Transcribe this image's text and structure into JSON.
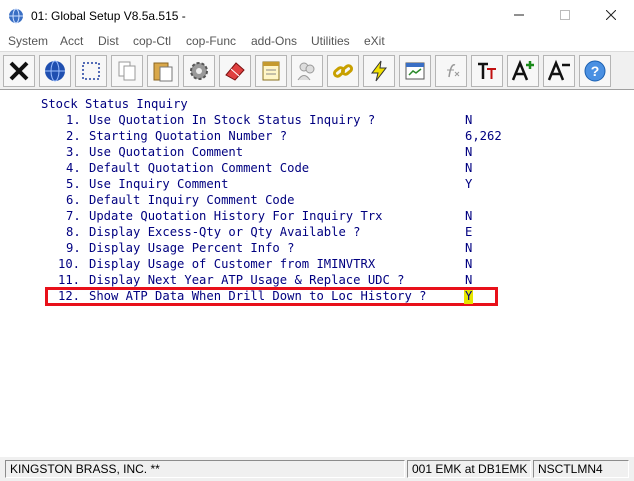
{
  "window": {
    "title": "01: Global Setup V8.5a.515 -",
    "minimize_icon": "minimize-icon",
    "maximize_icon": "maximize-icon",
    "close_icon": "close-icon"
  },
  "menu": {
    "items": [
      {
        "label": "System"
      },
      {
        "label": "Acct"
      },
      {
        "label": "Dist"
      },
      {
        "label": "cop-Ctl"
      },
      {
        "label": "cop-Func"
      },
      {
        "label": "add-Ons"
      },
      {
        "label": "Utilities"
      },
      {
        "label": "eXit"
      }
    ]
  },
  "toolbar": {
    "buttons": [
      {
        "icon": "close-x-icon"
      },
      {
        "icon": "globe-icon"
      },
      {
        "icon": "select-rectangle-icon"
      },
      {
        "icon": "copy-icon"
      },
      {
        "icon": "paste-icon"
      },
      {
        "icon": "settings-gear-icon"
      },
      {
        "icon": "eraser-icon"
      },
      {
        "icon": "notepad-icon"
      },
      {
        "icon": "users-icon"
      },
      {
        "icon": "link-chain-icon"
      },
      {
        "icon": "lightning-icon"
      },
      {
        "icon": "report-icon"
      },
      {
        "icon": "function-icon"
      },
      {
        "icon": "text-format-icon"
      },
      {
        "icon": "font-increase-icon"
      },
      {
        "icon": "font-decrease-icon"
      },
      {
        "icon": "help-icon"
      }
    ]
  },
  "screen": {
    "heading": "Stock Status Inquiry",
    "options": [
      {
        "num": "1.",
        "label": "Use Quotation In Stock Status Inquiry ?",
        "value": "N"
      },
      {
        "num": "2.",
        "label": "Starting Quotation Number ?",
        "value": "6,262"
      },
      {
        "num": "3.",
        "label": "Use Quotation Comment",
        "value": "N"
      },
      {
        "num": "4.",
        "label": "Default Quotation Comment Code",
        "value": "N"
      },
      {
        "num": "5.",
        "label": "Use Inquiry Comment",
        "value": "Y"
      },
      {
        "num": "6.",
        "label": "Default Inquiry Comment Code",
        "value": ""
      },
      {
        "num": "7.",
        "label": "Update Quotation History For Inquiry Trx",
        "value": "N"
      },
      {
        "num": "8.",
        "label": "Display Excess-Qty or Qty Available ?",
        "value": "E"
      },
      {
        "num": "9.",
        "label": "Display Usage Percent Info ?",
        "value": "N"
      },
      {
        "num": "10.",
        "label": "Display Usage of Customer from IMINVTRX",
        "value": "N"
      },
      {
        "num": "11.",
        "label": "Display Next Year ATP Usage & Replace UDC ?",
        "value": "N"
      },
      {
        "num": "12.",
        "label": "Show ATP Data When Drill Down to Loc History ?",
        "value": "Y"
      }
    ],
    "highlight_color": "#e8101a",
    "text_color": "#000080",
    "cursor_color": "#e6e600"
  },
  "status": {
    "company": "KINGSTON BRASS, INC. **",
    "session": "001 EMK at DB1EMK",
    "terminal": "NSCTLMN4"
  }
}
